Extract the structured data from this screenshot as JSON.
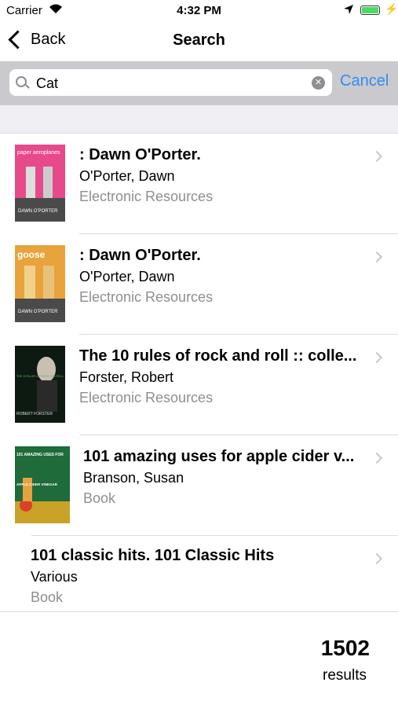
{
  "status_bar": {
    "carrier": "Carrier",
    "time": "4:32 PM"
  },
  "nav": {
    "back_label": "Back",
    "title": "Search"
  },
  "search": {
    "value": "Cat",
    "cancel_label": "Cancel"
  },
  "results": [
    {
      "title": ": Dawn O'Porter.",
      "author": "O'Porter, Dawn",
      "type": "Electronic Resources",
      "cover": {
        "top_text": "paper aeroplanes",
        "bottom_text": "DAWN O'PORTER"
      }
    },
    {
      "title": ": Dawn O'Porter.",
      "author": "O'Porter, Dawn",
      "type": "Electronic Resources",
      "cover": {
        "top_text": "goose",
        "bottom_text": "DAWN O'PORTER"
      }
    },
    {
      "title": "The 10 rules of rock and roll :: colle...",
      "author": "Forster, Robert",
      "type": "Electronic Resources",
      "cover": {
        "top_text": "THE 10 RULES OF ROCK AND ROLL",
        "bottom_text": "ROBERT FORSTER"
      }
    },
    {
      "title": "101 amazing uses for apple cider v...",
      "author": "Branson, Susan",
      "type": "Book",
      "cover": {
        "top_text": "101 AMAZING USES FOR",
        "bottom_text": "APPLE CIDER VINEGAR"
      }
    },
    {
      "title": "101 classic hits. 101 Classic Hits",
      "author": "Various",
      "type": "Book",
      "cover": null
    }
  ],
  "footer": {
    "count": "1502",
    "label": "results"
  },
  "colors": {
    "accent": "#2f8ef0",
    "search_bg": "#c9c9ce",
    "secondary_text": "#8e8e93"
  }
}
